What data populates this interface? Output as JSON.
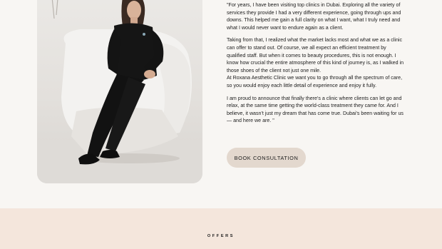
{
  "about": {
    "photo_alt": "",
    "paragraphs": [
      "\"For years, I have been visiting top clinics in Dubai. Exploring all the variety of services they provide I had a very different experience, going through ups and downs. This helped me gain a full clarity on what I want, what I truly need and what I would never want to endure again as a client.",
      "Taking from that, I realized what the market lacks most and what we as a clinic can offer to stand out. Of course, we all expect an efficient treatment by qualified staff. But when it comes to beauty procedures, this is not enough. I know how crucial the entire atmosphere of this kind of journey is, as I walked in those shoes of the client not just one mile.",
      "At Roxana Aesthetic Clinic we want you to go through all the spectrum of care, so you would enjoy each little detail of experience and enjoy it fully.",
      "I am proud to announce that finally there's a clinic where clients can let go and relax, at the same time getting the world-class treatment they came for. And I believe, it wasn't just my dream that has come true. Dubai's been waiting for us — and here we are. \""
    ],
    "cta_label": "BOOK CONSULTATION"
  },
  "offers": {
    "title": "OFFERS"
  },
  "colors": {
    "page_bg": "#f8f6f3",
    "cta_bg": "#e3d8ce",
    "offers_bg": "#f4e6dc"
  }
}
